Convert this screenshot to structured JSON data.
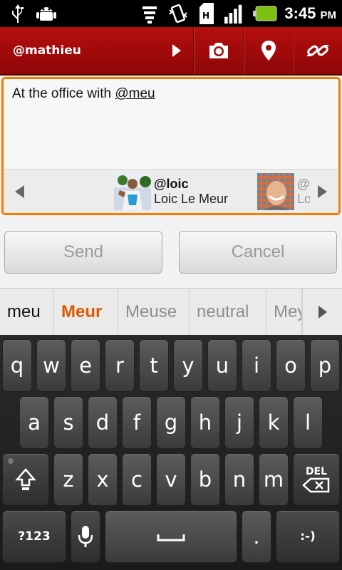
{
  "status_bar": {
    "time": "3:45",
    "ampm": "PM",
    "icons": [
      "usb-icon",
      "android-debug-icon",
      "wifi-icon",
      "vibrate-icon",
      "sim-icon",
      "signal-icon",
      "battery-icon"
    ]
  },
  "header": {
    "account": "@mathieu",
    "actions": [
      "camera-icon",
      "location-icon",
      "link-icon"
    ]
  },
  "compose": {
    "text_prefix": "At the office with ",
    "text_underlined": "@meu",
    "suggestions": [
      {
        "handle": "@loic",
        "name": "Loic Le Meur"
      },
      {
        "handle": "@",
        "name": "Lo"
      }
    ]
  },
  "buttons": {
    "send": "Send",
    "cancel": "Cancel"
  },
  "candidates": {
    "typed": "meu",
    "best": "Meur",
    "others": [
      "Meuse",
      "neutral",
      "Mey"
    ]
  },
  "keyboard": {
    "row1": [
      "q",
      "w",
      "e",
      "r",
      "t",
      "y",
      "u",
      "i",
      "o",
      "p"
    ],
    "row2": [
      "a",
      "s",
      "d",
      "f",
      "g",
      "h",
      "j",
      "k",
      "l"
    ],
    "row3": [
      "z",
      "x",
      "c",
      "v",
      "b",
      "n",
      "m"
    ],
    "symbols": "?123",
    "del_label": "DEL",
    "period": ".",
    "smiley": ":-)"
  },
  "colors": {
    "header_red": "#a50c0c",
    "focus_orange": "#f57c00",
    "suggestion_orange": "#e05a00",
    "battery_green": "#7cc00f"
  }
}
